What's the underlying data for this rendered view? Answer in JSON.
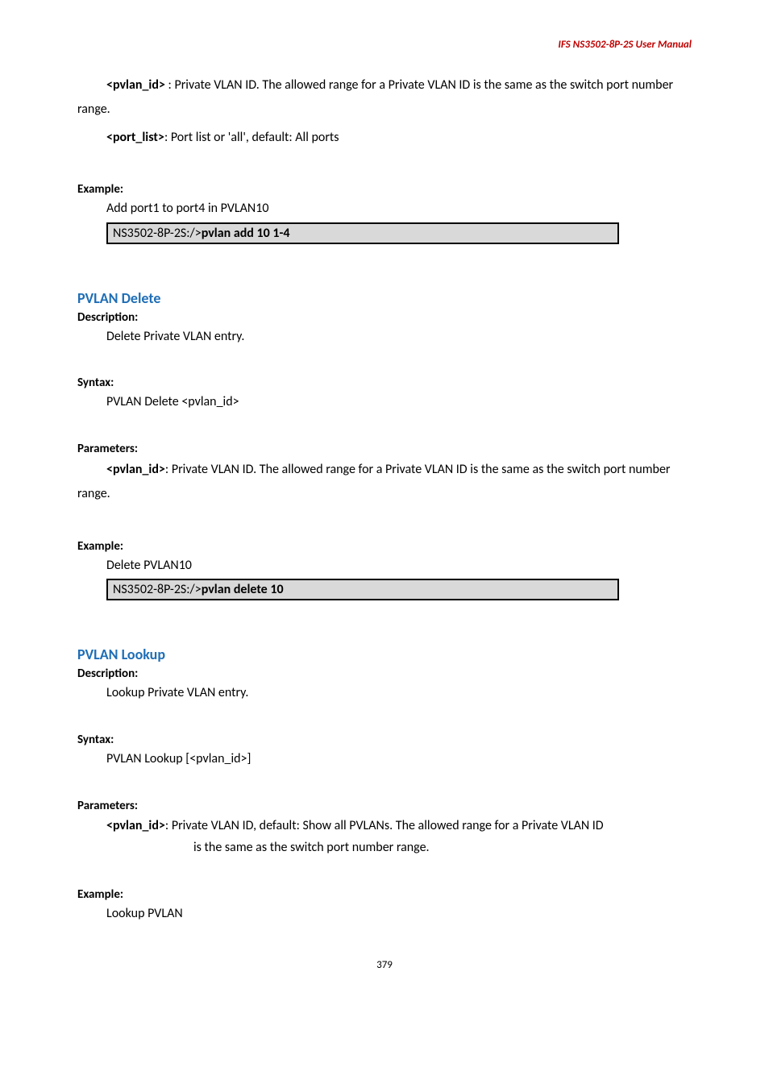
{
  "header": {
    "product": "IFS  NS3502-8P-2S  User  Manual"
  },
  "intro": {
    "pvlan_id_label": "<pvlan_id>",
    "pvlan_id_desc": " : Private VLAN ID. The allowed range for a Private VLAN ID is the same as the switch port number range.",
    "port_list_label": "<port_list>",
    "port_list_desc": ": Port list or 'all', default: All ports"
  },
  "example1": {
    "label": "Example:",
    "desc": "Add port1 to port4 in PVLAN10",
    "prompt": "NS3502-8P-2S:/>",
    "cmd": "pvlan add 10 1-4"
  },
  "delete": {
    "title": "PVLAN Delete",
    "desc_label": "Description:",
    "desc": "Delete Private VLAN entry.",
    "syntax_label": "Syntax:",
    "syntax": "PVLAN Delete <pvlan_id>",
    "params_label": "Parameters:",
    "param_key": "<pvlan_id>",
    "param_desc": ": Private VLAN ID. The allowed range for a Private VLAN ID is the same as the switch port number range.",
    "example_label": "Example:",
    "example_desc": "Delete PVLAN10",
    "prompt": "NS3502-8P-2S:/>",
    "cmd": "pvlan delete 10"
  },
  "lookup": {
    "title": "PVLAN Lookup",
    "desc_label": "Description:",
    "desc": "Lookup Private VLAN entry.",
    "syntax_label": "Syntax:",
    "syntax": "PVLAN Lookup [<pvlan_id>]",
    "params_label": "Parameters:",
    "param_key": "<pvlan_id>",
    "param_line1": ": Private VLAN ID, default: Show all PVLANs. The allowed range for a Private VLAN ID",
    "param_line2": "is the same as the switch port number range.",
    "example_label": "Example:",
    "example_desc": "Lookup PVLAN"
  },
  "page_number": "379"
}
